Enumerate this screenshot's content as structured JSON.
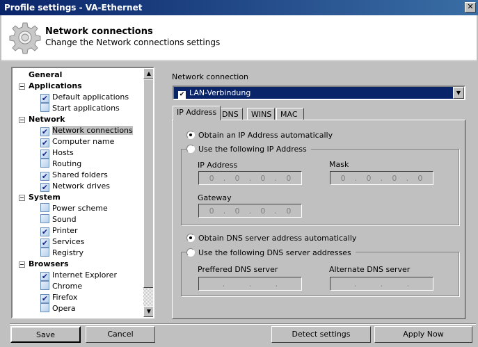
{
  "window": {
    "title": "Profile settings - VA-Ethernet",
    "close": "✕"
  },
  "header": {
    "title": "Network connections",
    "subtitle": "Change the Network connections settings",
    "icon": "gear-icon"
  },
  "tree": {
    "categories": [
      {
        "label": "General",
        "items": []
      },
      {
        "label": "Applications",
        "items": [
          {
            "label": "Default applications",
            "checked": true
          },
          {
            "label": "Start applications",
            "checked": false
          }
        ]
      },
      {
        "label": "Network",
        "items": [
          {
            "label": "Network connections",
            "checked": true,
            "selected": true
          },
          {
            "label": "Computer name",
            "checked": true
          },
          {
            "label": "Hosts",
            "checked": true
          },
          {
            "label": "Routing",
            "checked": false
          },
          {
            "label": "Shared folders",
            "checked": true
          },
          {
            "label": "Network drives",
            "checked": true
          }
        ]
      },
      {
        "label": "System",
        "items": [
          {
            "label": "Power scheme",
            "checked": false
          },
          {
            "label": "Sound",
            "checked": false
          },
          {
            "label": "Printer",
            "checked": true
          },
          {
            "label": "Services",
            "checked": true
          },
          {
            "label": "Registry",
            "checked": false
          }
        ]
      },
      {
        "label": "Browsers",
        "items": [
          {
            "label": "Internet Explorer",
            "checked": true
          },
          {
            "label": "Chrome",
            "checked": false
          },
          {
            "label": "Firefox",
            "checked": true
          },
          {
            "label": "Opera",
            "checked": false
          }
        ]
      }
    ]
  },
  "connection": {
    "label": "Network connection",
    "selected": "LAN-Verbindung",
    "checked": true
  },
  "tabs": [
    "IP Address",
    "DNS",
    "WINS",
    "MAC"
  ],
  "active_tab": "IP Address",
  "ip": {
    "auto_label": "Obtain an IP Address automatically",
    "auto_selected": true,
    "manual_label": "Use the following IP Address",
    "ip_label": "IP Address",
    "ip_value": [
      "0",
      "0",
      "0",
      "0"
    ],
    "mask_label": "Mask",
    "mask_value": [
      "0",
      "0",
      "0",
      "0"
    ],
    "gateway_label": "Gateway",
    "gateway_value": [
      "0",
      "0",
      "0",
      "0"
    ]
  },
  "dns": {
    "auto_label": "Obtain DNS server address automatically",
    "auto_selected": true,
    "manual_label": "Use the following DNS server addresses",
    "preferred_label": "Preffered DNS server",
    "alternate_label": "Alternate DNS server"
  },
  "buttons": {
    "save": "Save",
    "cancel": "Cancel",
    "detect": "Detect settings",
    "apply": "Apply Now"
  }
}
